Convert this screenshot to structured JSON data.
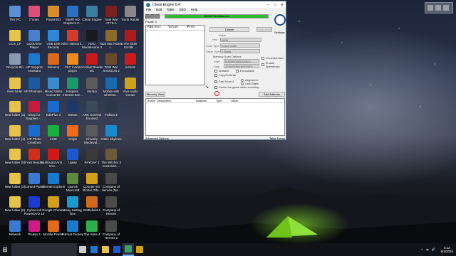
{
  "desktop": {
    "icons": [
      {
        "label": "This PC",
        "color": "#5a8fd6"
      },
      {
        "label": "iTunes",
        "color": "#e04f7a"
      },
      {
        "label": "PowerISO",
        "color": "#d98c2b"
      },
      {
        "label": "Intel® HD Graphics C...",
        "color": "#2a6fc4"
      },
      {
        "label": "Cheat Engine",
        "color": "#3a7fa0"
      },
      {
        "label": "Total War ATTILA",
        "color": "#7a1f1f"
      },
      {
        "label": "Tomb Raider",
        "color": "#888888"
      },
      {
        "label": "CCS_LP",
        "color": "#e6c34a"
      },
      {
        "label": "QuickTime Player",
        "color": "#4a7fd0"
      },
      {
        "label": "USB Disk Security",
        "color": "#2f87d8"
      },
      {
        "label": "Killer Network...",
        "color": "#d33a2a"
      },
      {
        "label": "Nero MediaHome 4",
        "color": "#1a1a1a"
      },
      {
        "label": "Total War ROME I...",
        "color": "#8a6a2a"
      },
      {
        "label": "The Elder Scrolls ...",
        "color": "#b01a1a"
      },
      {
        "label": "Recycle Bin",
        "color": "#8a9ab0"
      },
      {
        "label": "HP Support Assistant",
        "color": "#1a7ad0"
      },
      {
        "label": "Winamp",
        "color": "#d86a1a"
      },
      {
        "label": "VLC media player",
        "color": "#f08a1a"
      },
      {
        "label": "Acrobat Reader DC",
        "color": "#c81a1a"
      },
      {
        "label": "Total War SHOGUN 2",
        "color": "#6a4a2a"
      },
      {
        "label": "iAction!",
        "color": "#d01a1a"
      },
      {
        "label": "New folder",
        "color": "#e6c34a"
      },
      {
        "label": "HP Photosm...",
        "color": "#1a5aa0"
      },
      {
        "label": "Mixed Video Converter",
        "color": "#3a8ad0"
      },
      {
        "label": "Kaspers. Internet Sec...",
        "color": "#1a9a6a"
      },
      {
        "label": "Verdun",
        "color": "#5a5a5a"
      },
      {
        "label": "Mobile with wireless...",
        "color": "#1a6ab0"
      },
      {
        "label": "Vive Audio Center",
        "color": "#d0a01a"
      },
      {
        "label": "New folder (3)",
        "color": "#e6c34a"
      },
      {
        "label": "Shop for Supplies -...",
        "color": "#c81a3a"
      },
      {
        "label": "EditPlus 3",
        "color": "#1a6ad0"
      },
      {
        "label": "Steam",
        "color": "#1a3a6a"
      },
      {
        "label": "ARK Survival Evolved",
        "color": "#3a4a5a"
      },
      {
        "label": "Fallout 4",
        "color": "#2a3a4a"
      },
      {
        "label": "",
        "color": "rgba(0,0,0,0)"
      },
      {
        "label": "New folder (4)",
        "color": "#e6c34a"
      },
      {
        "label": "HP Photo Creations",
        "color": "#1a6ad0"
      },
      {
        "label": "LINE",
        "color": "#1ab040"
      },
      {
        "label": "Origin",
        "color": "#f06a1a"
      },
      {
        "label": "Chivalry Medieval...",
        "color": "#5a5a5a"
      },
      {
        "label": "Cities Skylines",
        "color": "#1a8ad0"
      },
      {
        "label": "",
        "color": "rgba(0,0,0,0)"
      },
      {
        "label": "New folder (5)",
        "color": "#e6c34a"
      },
      {
        "label": "Foxit Reader",
        "color": "#d0301a"
      },
      {
        "label": "BullGuard Anti ... Exe...",
        "color": "#d01a1a"
      },
      {
        "label": "Uplay",
        "color": "#1a5ad0"
      },
      {
        "label": "PAYDAY 2",
        "color": "#3a3a3a"
      },
      {
        "label": "The Witcher 3 Assassins ...",
        "color": "#6a5a3a"
      },
      {
        "label": "",
        "color": "rgba(0,0,0,0)"
      },
      {
        "label": "New folder (2)",
        "color": "#e6c34a"
      },
      {
        "label": "Control Panel",
        "color": "#3a7ad0"
      },
      {
        "label": "Internet Explorer",
        "color": "#1a7ad0"
      },
      {
        "label": "Launch Minecraft",
        "color": "#5a8a3a"
      },
      {
        "label": "Counter-Str. Global Offe...",
        "color": "#d0a01a"
      },
      {
        "label": "Company of Heroes (Ne...",
        "color": "#4a4a4a"
      },
      {
        "label": "",
        "color": "rgba(0,0,0,0)"
      },
      {
        "label": "New folder (6)",
        "color": "#e6c34a"
      },
      {
        "label": "CyberLink PowerDVD 14",
        "color": "#1a3ad0"
      },
      {
        "label": "Google Chrome",
        "color": "#d0a01a"
      },
      {
        "label": "Easy Setting Box",
        "color": "#1a9ad0"
      },
      {
        "label": "Battlefield 4",
        "color": "#d06a1a"
      },
      {
        "label": "Company of Heroes",
        "color": "#4a4a4a"
      },
      {
        "label": "",
        "color": "rgba(0,0,0,0)"
      },
      {
        "label": "Network",
        "color": "#3a7ad0"
      },
      {
        "label": "Picasa 3",
        "color": "#d01a8a"
      },
      {
        "label": "Mozilla Firefox",
        "color": "#e06a1a"
      },
      {
        "label": "Format Factory",
        "color": "#1a7ad0"
      },
      {
        "label": "The Sims 4",
        "color": "#2ab04a"
      },
      {
        "label": "Company of Heroes 2",
        "color": "#4a4a4a"
      },
      {
        "label": "",
        "color": "rgba(0,0,0,0)"
      }
    ]
  },
  "cheat_engine": {
    "title": "Cheat Engine 6.4",
    "menu": [
      "File",
      "Edit",
      "Table",
      "D3D",
      "Help"
    ],
    "process": "00000718-Attila.exe",
    "progress_fraction": 1.0,
    "found_label": "Found: 0",
    "list_headers": [
      "Address",
      "Value",
      "Prev"
    ],
    "logo_label": "Settings",
    "buttons": {
      "first_scan": "Cancel",
      "next_scan": "Next Scan",
      "undo_scan": "Undo Scan",
      "memory_view": "Memory View",
      "add_manually": "Add Address Manually"
    },
    "labels": {
      "value": "Value",
      "hex": "Hex",
      "scan_type": "Scan Type",
      "value_type": "Value Type",
      "memory_scan_options": "Memory Scan Options",
      "start": "Start",
      "stop": "Stop",
      "writable": "Writable",
      "executable": "Executable",
      "copy_on_write": "CopyOnWrite",
      "fast_scan": "Fast Scan",
      "alignment": "Alignment",
      "last_digits": "Last Digits",
      "pause_game": "Pause the game while scanning"
    },
    "fields": {
      "value": "5000",
      "scan_type": "Exact Value",
      "value_type": "4 Bytes",
      "start": "0000000000000000",
      "stop": "7FFFFFFFFFFFFFFF",
      "fast_scan": "4"
    },
    "checks": {
      "unrandomizer": "Unrandomizer",
      "speedhack": "Enable Speedhack"
    },
    "table_headers": [
      "Active",
      "Description",
      "Address",
      "Type",
      "Value"
    ],
    "footer_left": "Advanced Options",
    "footer_right": "Table Extras"
  },
  "taskbar": {
    "search_text": "",
    "apps": [
      {
        "name": "task-view",
        "color": "#cccccc"
      },
      {
        "name": "edge",
        "color": "#1a7ad0"
      },
      {
        "name": "file-explorer",
        "color": "#e6c34a"
      },
      {
        "name": "store",
        "color": "#1a5ad0"
      },
      {
        "name": "cheat-engine",
        "color": "#3aa06a",
        "active": true
      },
      {
        "name": "chrome",
        "color": "#d0a01a"
      }
    ],
    "tray_symbols": [
      "^",
      "☁",
      "🔊"
    ],
    "time": "4:12",
    "date": "6/4/2016"
  }
}
